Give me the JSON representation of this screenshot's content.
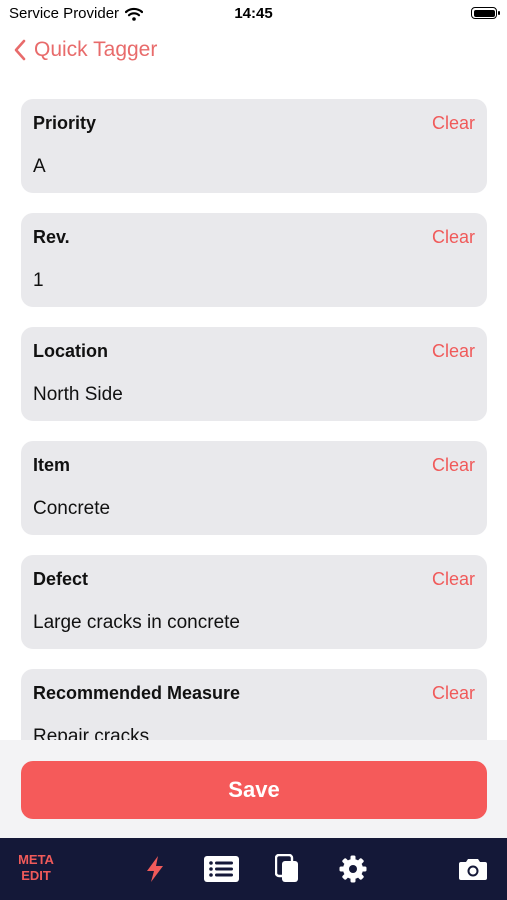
{
  "status_bar": {
    "carrier": "Service Provider",
    "time": "14:45"
  },
  "nav": {
    "back_label": "Quick Tagger",
    "accent": "#e86b6b"
  },
  "fields": [
    {
      "label": "Priority",
      "clear_label": "Clear",
      "value": "A"
    },
    {
      "label": "Rev.",
      "clear_label": "Clear",
      "value": "1"
    },
    {
      "label": "Location",
      "clear_label": "Clear",
      "value": "North Side"
    },
    {
      "label": "Item",
      "clear_label": "Clear",
      "value": "Concrete"
    },
    {
      "label": "Defect",
      "clear_label": "Clear",
      "value": "Large cracks in concrete"
    },
    {
      "label": "Recommended Measure",
      "clear_label": "Clear",
      "value": "Repair cracks"
    }
  ],
  "save_label": "Save",
  "tab_bar": {
    "meta_edit_line1": "META",
    "meta_edit_line2": "EDIT",
    "icons": [
      "lightning-icon",
      "list-icon",
      "copy-icon",
      "gear-icon",
      "camera-icon"
    ],
    "background": "#141838",
    "active_color": "#f05a5a"
  }
}
